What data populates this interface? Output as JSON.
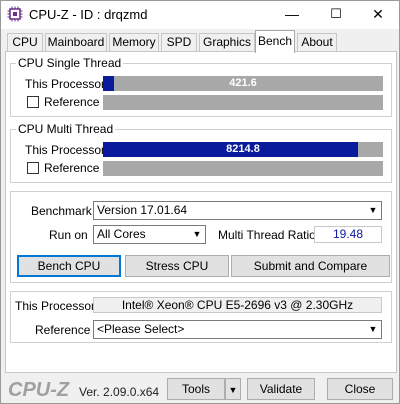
{
  "window": {
    "title": "CPU-Z - ID : drqzmd",
    "minimize_glyph": "—",
    "maximize_glyph": "☐",
    "close_glyph": "✕"
  },
  "tabs": [
    {
      "label": "CPU"
    },
    {
      "label": "Mainboard"
    },
    {
      "label": "Memory"
    },
    {
      "label": "SPD"
    },
    {
      "label": "Graphics"
    },
    {
      "label": "Bench"
    },
    {
      "label": "About"
    }
  ],
  "single_thread": {
    "title": "CPU Single Thread",
    "this_label": "This Processor",
    "this_value": "421.6",
    "this_fraction": 0.04,
    "ref_label": "Reference",
    "ref_checked": false
  },
  "multi_thread": {
    "title": "CPU Multi Thread",
    "this_label": "This Processor",
    "this_value": "8214.8",
    "this_fraction": 0.91,
    "ref_label": "Reference",
    "ref_checked": false
  },
  "settings": {
    "benchmark_label": "Benchmark",
    "benchmark_value": "Version 17.01.64",
    "runon_label": "Run on",
    "runon_value": "All Cores",
    "ratio_label": "Multi Thread Ratio",
    "ratio_value": "19.48"
  },
  "buttons": {
    "bench_cpu": "Bench CPU",
    "stress_cpu": "Stress CPU",
    "submit": "Submit and Compare"
  },
  "processor": {
    "this_label": "This Processor",
    "this_value": "Intel® Xeon® CPU E5-2696 v3 @ 2.30GHz",
    "ref_label": "Reference",
    "ref_value": "<Please Select>"
  },
  "footer": {
    "logo": "CPU-Z",
    "version": "Ver. 2.09.0.x64",
    "tools": "Tools",
    "validate": "Validate",
    "close": "Close"
  },
  "colors": {
    "bar_fill": "#0a1a9c",
    "bar_bg": "#a8a8a8",
    "accent_focus": "#0078d7"
  }
}
